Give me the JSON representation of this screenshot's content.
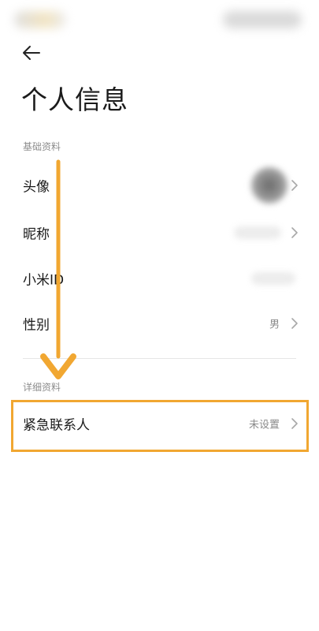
{
  "header": {
    "back_icon": "back-arrow-icon",
    "title": "个人信息"
  },
  "sections": {
    "basic": {
      "label": "基础资料",
      "rows": [
        {
          "label": "头像",
          "value": "",
          "icon": "chevron-right-icon"
        },
        {
          "label": "昵称",
          "value": "",
          "icon": "chevron-right-icon"
        },
        {
          "label": "小米ID",
          "value": "",
          "icon": "chevron-right-icon"
        },
        {
          "label": "性别",
          "value": "男",
          "icon": "chevron-right-icon"
        }
      ]
    },
    "detail": {
      "label": "详细资料",
      "rows": [
        {
          "label": "紧急联系人",
          "value": "未设置",
          "icon": "chevron-right-icon"
        }
      ]
    }
  },
  "colors": {
    "annotation_orange": "#f1a731",
    "text_primary": "#1a1a1a",
    "text_secondary": "#8a8a8a"
  }
}
